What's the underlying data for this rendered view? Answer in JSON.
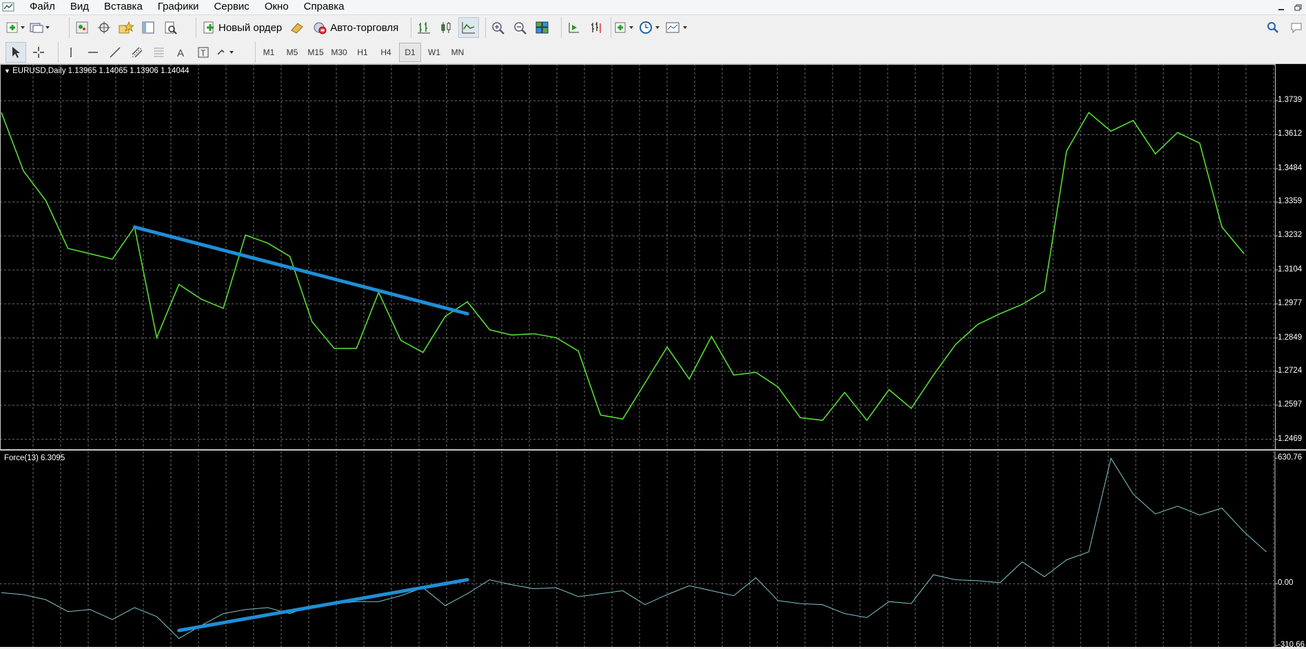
{
  "menu": {
    "items": [
      "Файл",
      "Вид",
      "Вставка",
      "Графики",
      "Сервис",
      "Окно",
      "Справка"
    ]
  },
  "toolbar": {
    "new_order_label": "Новый ордер",
    "autotrading_label": "Авто-торговля"
  },
  "timeframes": [
    "M1",
    "M5",
    "M15",
    "M30",
    "H1",
    "H4",
    "D1",
    "W1",
    "MN"
  ],
  "active_timeframe": "D1",
  "chart": {
    "symbol_label": "EURUSD,Daily",
    "ohlc": "1.13965 1.14065 1.13906 1.14044",
    "indicator_label": "Force(13) 6.3095"
  },
  "chart_data": [
    {
      "type": "line",
      "name": "EURUSD,Daily",
      "price_axis_ticks": [
        "1.3739",
        "1.3612",
        "1.3484",
        "1.3359",
        "1.3232",
        "1.3104",
        "1.2977",
        "1.2849",
        "1.2724",
        "1.2597",
        "1.2469"
      ],
      "ylim": [
        1.2455,
        1.3825
      ],
      "values": [
        1.3695,
        1.3475,
        1.3365,
        1.3185,
        1.3165,
        1.3145,
        1.3265,
        1.285,
        1.305,
        1.2995,
        1.296,
        1.3235,
        1.3205,
        1.3155,
        1.291,
        1.281,
        1.281,
        1.302,
        1.284,
        1.2795,
        1.293,
        1.2985,
        1.288,
        1.286,
        1.2865,
        1.285,
        1.28,
        1.256,
        1.2545,
        1.268,
        1.2815,
        1.2695,
        1.2855,
        1.271,
        1.272,
        1.2665,
        1.255,
        1.254,
        1.2645,
        1.254,
        1.2655,
        1.2585,
        1.271,
        1.2825,
        1.29,
        1.294,
        1.2975,
        1.3025,
        1.355,
        1.3695,
        1.3625,
        1.3665,
        1.354,
        1.362,
        1.358,
        1.3265,
        1.3165
      ],
      "trendline": [
        [
          6,
          1.3265
        ],
        [
          21,
          1.294
        ]
      ],
      "color": "#55dd33"
    },
    {
      "type": "line",
      "name": "Force(13)",
      "value_axis_ticks": [
        "630.76",
        "0.00",
        "-310.66"
      ],
      "ylim": [
        -310.66,
        630.76
      ],
      "values": [
        -45,
        -55,
        -80,
        -140,
        -130,
        -180,
        -120,
        -165,
        -275,
        -210,
        -150,
        -130,
        -120,
        -150,
        -110,
        -100,
        -90,
        -90,
        -60,
        -20,
        -110,
        -50,
        20,
        -5,
        -25,
        -20,
        -65,
        -50,
        -35,
        -105,
        -55,
        -10,
        -35,
        -60,
        30,
        -85,
        -100,
        -105,
        -150,
        -170,
        -90,
        -100,
        45,
        20,
        15,
        5,
        110,
        35,
        120,
        160,
        630,
        450,
        350,
        390,
        345,
        380,
        260,
        160
      ],
      "trendline": [
        [
          8,
          -235
        ],
        [
          21,
          20
        ]
      ],
      "color": "#7fc6cf"
    }
  ],
  "colors": {
    "background": "#000000",
    "grid": "#c8c8c8",
    "price_line": "#55dd33",
    "indicator_line": "#7fc6cf",
    "trendline": "#1e8fd6"
  }
}
